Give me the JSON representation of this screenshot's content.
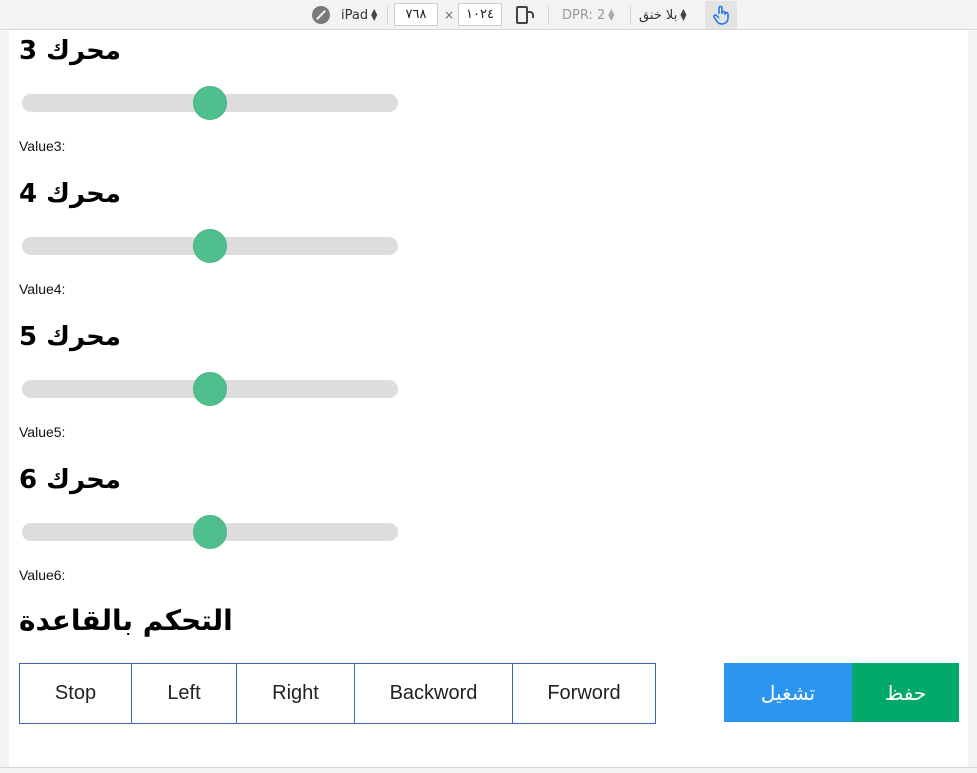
{
  "devtools": {
    "device": "iPad",
    "width": "١٠٢٤",
    "times": "×",
    "height": "٧٦٨",
    "dpr": "DPR: 2",
    "throttle": "بلا خنق"
  },
  "motors": [
    {
      "title": "محرك 3",
      "value_label": "Value3:",
      "level": 0.5
    },
    {
      "title": "محرك 4",
      "value_label": "Value4:",
      "level": 0.5
    },
    {
      "title": "محرك 5",
      "value_label": "Value5:",
      "level": 0.5
    },
    {
      "title": "محرك 6",
      "value_label": "Value6:",
      "level": 0.5
    }
  ],
  "base": {
    "title": "التحكم بالقاعدة",
    "buttons": [
      "Stop",
      "Left",
      "Right",
      "Backword",
      "Forword"
    ]
  },
  "actions": {
    "run_label": "تشغيل",
    "save_label": "حفظ"
  },
  "colors": {
    "thumb": "#4fc08d",
    "run": "#2a96f0",
    "save": "#03a86b",
    "button_border": "#3a66b5"
  }
}
